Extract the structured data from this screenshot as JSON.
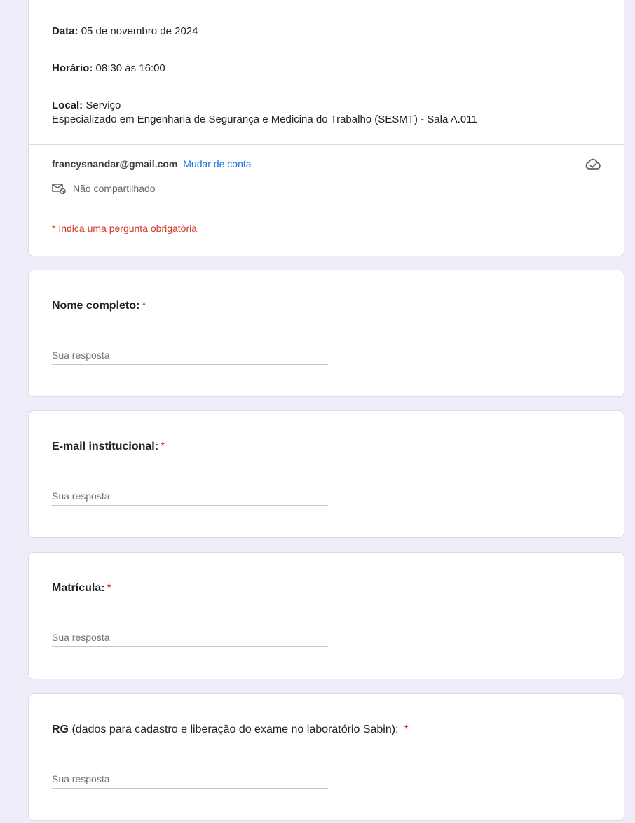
{
  "header": {
    "date_label": "Data:",
    "date_value": "05 de novembro de 2024",
    "time_label": "Horário:",
    "time_value": "08:30 às 16:00",
    "location_label": "Local:",
    "location_value_line1": "Serviço",
    "location_value_line2": "Especializado em Engenharia de Segurança e Medicina do Trabalho (SESMT) - Sala A.011"
  },
  "account": {
    "email": "francysnandar@gmail.com",
    "switch_label": "Mudar de conta",
    "not_shared": "Não compartilhado",
    "cloud_icon": "cloud-saved-icon",
    "mail_icon": "mail-not-shared-icon"
  },
  "required_note": "* Indica uma pergunta obrigatória",
  "questions": [
    {
      "title": "Nome completo:",
      "extra": "",
      "required_mark": "*",
      "placeholder": "Sua resposta"
    },
    {
      "title": "E-mail institucional:",
      "extra": "",
      "required_mark": "*",
      "placeholder": "Sua resposta"
    },
    {
      "title": "Matrícula:",
      "extra": "",
      "required_mark": "*",
      "placeholder": "Sua resposta"
    },
    {
      "title": "RG",
      "extra": " (dados para cadastro e liberação do exame no laboratório Sabin):",
      "required_mark": "*",
      "placeholder": "Sua resposta"
    }
  ],
  "colors": {
    "background": "#efebf8",
    "required": "#d93025",
    "link": "#1a73e8"
  }
}
